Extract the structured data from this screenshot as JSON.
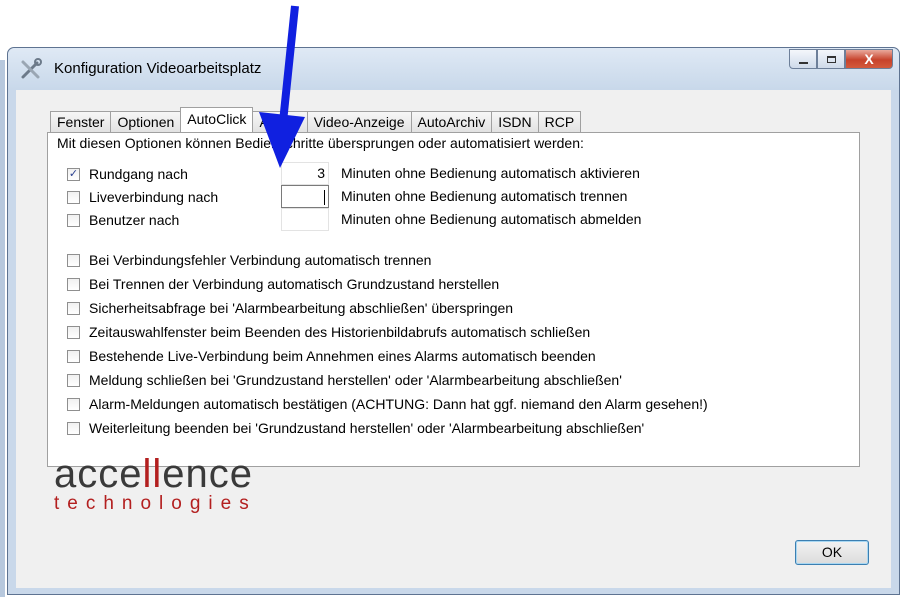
{
  "window": {
    "title": "Konfiguration Videoarbeitsplatz",
    "app_icon": "tools-icon",
    "caption_buttons": {
      "minimize": "minimize-icon",
      "maximize": "maximize-icon",
      "close_glyph": "X"
    }
  },
  "tabs": [
    {
      "label": "Fenster",
      "active": false
    },
    {
      "label": "Optionen",
      "active": false
    },
    {
      "label": "AutoClick",
      "active": true
    },
    {
      "label": "Anrufe",
      "active": false
    },
    {
      "label": "Video-Anzeige",
      "active": false
    },
    {
      "label": "AutoArchiv",
      "active": false
    },
    {
      "label": "ISDN",
      "active": false
    },
    {
      "label": "RCP",
      "active": false
    }
  ],
  "panel": {
    "intro": "Mit diesen Optionen können Bedienschritte übersprungen oder automatisiert werden:",
    "timed_options": [
      {
        "label": "Rundgang nach",
        "checked": true,
        "value": "3",
        "suffix": "Minuten ohne Bedienung automatisch aktivieren"
      },
      {
        "label": "Liveverbindung nach",
        "checked": false,
        "value": "",
        "suffix": "Minuten ohne Bedienung automatisch trennen"
      },
      {
        "label": "Benutzer nach",
        "checked": false,
        "value": "",
        "suffix": "Minuten ohne Bedienung automatisch abmelden"
      }
    ],
    "options": [
      {
        "label": "Bei Verbindungsfehler Verbindung automatisch trennen",
        "checked": false
      },
      {
        "label": "Bei Trennen der Verbindung automatisch Grundzustand herstellen",
        "checked": false
      },
      {
        "label": "Sicherheitsabfrage bei 'Alarmbearbeitung abschließen' überspringen",
        "checked": false
      },
      {
        "label": "Zeitauswahlfenster beim Beenden des Historienbildabrufs automatisch schließen",
        "checked": false
      },
      {
        "label": "Bestehende Live-Verbindung beim Annehmen eines Alarms automatisch beenden",
        "checked": false
      },
      {
        "label": "Meldung schließen bei 'Grundzustand herstellen' oder 'Alarmbearbeitung abschließen'",
        "checked": false
      },
      {
        "label": "Alarm-Meldungen automatisch bestätigen (ACHTUNG: Dann hat ggf. niemand den Alarm gesehen!)",
        "checked": false
      },
      {
        "label": "Weiterleitung beenden bei 'Grundzustand herstellen' oder 'Alarmbearbeitung abschließen'",
        "checked": false
      }
    ]
  },
  "logo": {
    "part1": "acce",
    "part2": "ll",
    "part3": "ence",
    "sub": "technologies"
  },
  "buttons": {
    "ok": "OK"
  },
  "colors": {
    "arrow": "#1020e0",
    "logo_red": "#b31f1f",
    "logo_gray": "#3a3a3a",
    "window_frame": "#c9d8ea"
  }
}
